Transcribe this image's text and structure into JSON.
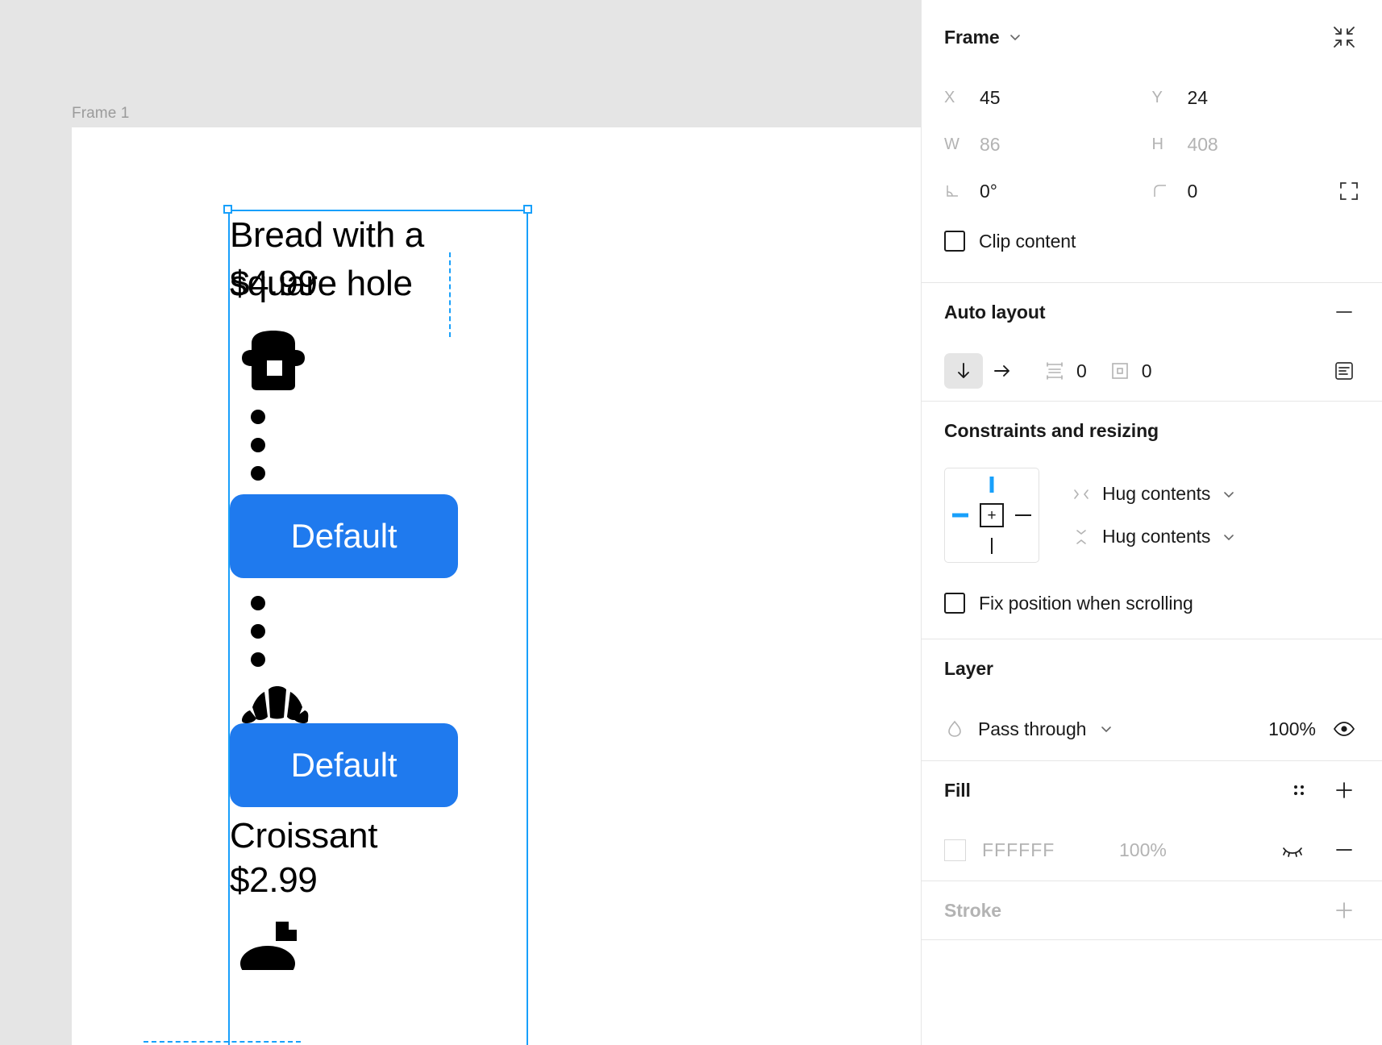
{
  "canvas": {
    "frame_label": "Frame 1",
    "design": {
      "item1_title": "Bread with a\nsquare hole",
      "item1_price": "$4.99",
      "item1_icon": "bread-slice-icon",
      "button1_label": "Default",
      "button2_label": "Default",
      "item2_icon": "croissant-icon",
      "item2_name": "Croissant",
      "item2_price": "$2.99",
      "accent_blue": "#1f7aee"
    },
    "selection_color": "#18a0fb"
  },
  "panel": {
    "header": {
      "title": "Frame",
      "chevron": "chevron-down-icon",
      "collapse_icon": "collapse-arrows-icon"
    },
    "position": {
      "x_label": "X",
      "x_value": "45",
      "y_label": "Y",
      "y_value": "24",
      "w_label": "W",
      "w_value": "86",
      "h_label": "H",
      "h_value": "408",
      "rotation_icon": "angle-icon",
      "rotation_value": "0°",
      "corner_icon": "corner-radius-icon",
      "corner_value": "0",
      "independent_corners_icon": "independent-corners-icon"
    },
    "clip_content": {
      "label": "Clip content",
      "checked": false
    },
    "auto_layout": {
      "title": "Auto layout",
      "remove_icon": "minus-icon",
      "direction_vertical_icon": "arrow-down-icon",
      "direction_horizontal_icon": "arrow-right-icon",
      "spacing_icon": "spacing-icon",
      "spacing_value": "0",
      "padding_icon": "padding-icon",
      "padding_value": "0",
      "alignment_icon": "alignment-icon",
      "selected_direction": "vertical"
    },
    "constraints": {
      "title": "Constraints and resizing",
      "widget_center_icon": "plus-icon",
      "active_edges": [
        "top",
        "left"
      ],
      "horizontal_icon": "horizontal-resize-icon",
      "horizontal_value": "Hug contents",
      "vertical_icon": "vertical-resize-icon",
      "vertical_value": "Hug contents",
      "fix_position": {
        "label": "Fix position when scrolling",
        "checked": false
      }
    },
    "layer": {
      "title": "Layer",
      "blend_icon": "blend-mode-icon",
      "blend_mode": "Pass through",
      "opacity": "100%",
      "visibility_icon": "eye-visible-icon"
    },
    "fill": {
      "title": "Fill",
      "styles_icon": "four-dots-icon",
      "add_icon": "plus-icon",
      "swatch_color": "#FFFFFF",
      "hex": "FFFFFF",
      "opacity": "100%",
      "visibility_icon": "eye-hidden-icon",
      "remove_icon": "minus-icon"
    },
    "stroke": {
      "title": "Stroke",
      "add_icon": "plus-icon"
    }
  }
}
